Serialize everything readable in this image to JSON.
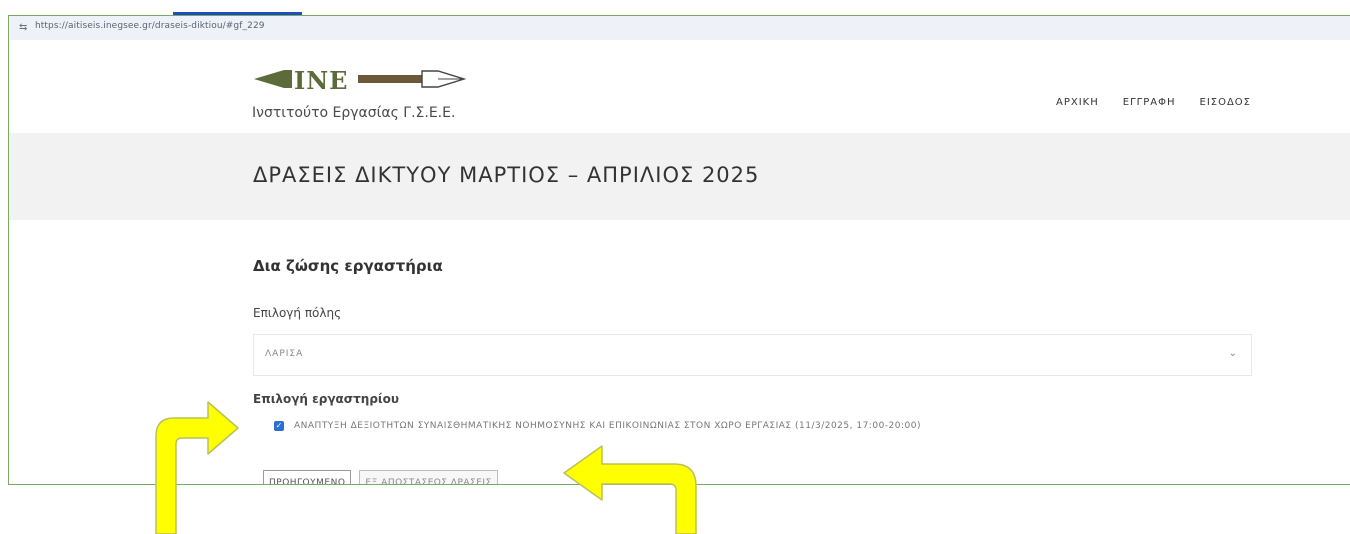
{
  "browser": {
    "url": "https://aitiseis.inegsee.gr/draseis-diktiou/#gf_229"
  },
  "site": {
    "logo_caption": "Ινστιτούτο Εργασίας Γ.Σ.Ε.Ε.",
    "logo_mark": "INE",
    "nav": [
      "ΑΡΧΙΚΗ",
      "ΕΓΓΡΑΦΗ",
      "ΕΙΣΟΔΟΣ"
    ]
  },
  "page": {
    "title": "ΔΡΑΣΕΙΣ ΔΙΚΤΥΟΥ ΜΑΡΤΙΟΣ – ΑΠΡΙΛΙΟΣ 2025"
  },
  "form": {
    "section_title": "Δια ζώσης εργαστήρια",
    "city_label": "Επιλογή πόλης",
    "city_value": "ΛΑΡΙΣΑ",
    "workshop_label": "Επιλογή εργαστηρίου",
    "workshop_option": "ΑΝΑΠΤΥΞΗ ΔΕΞΙΟΤΗΤΩΝ ΣΥΝΑΙΣΘΗΜΑΤΙΚΗΣ ΝΟΗΜΟΣΥΝΗΣ ΚΑΙ ΕΠΙΚΟΙΝΩΝΙΑΣ ΣΤΟΝ ΧΩΡΟ ΕΡΓΑΣΙΑΣ (11/3/2025, 17:00-20:00)",
    "workshop_checked": true,
    "prev_button": "ΠΡΟΗΓΟΥΜΕΝΟ",
    "remote_button": "ΕΞ ΑΠΟΣΤΑΣΕΩΣ ΔΡΑΣΕΙΣ"
  },
  "colors": {
    "annotation_arrow": "#ffff00",
    "frame_border": "#7aa866",
    "checkbox": "#2b6fd3",
    "logo_green": "#5b6b3a"
  }
}
